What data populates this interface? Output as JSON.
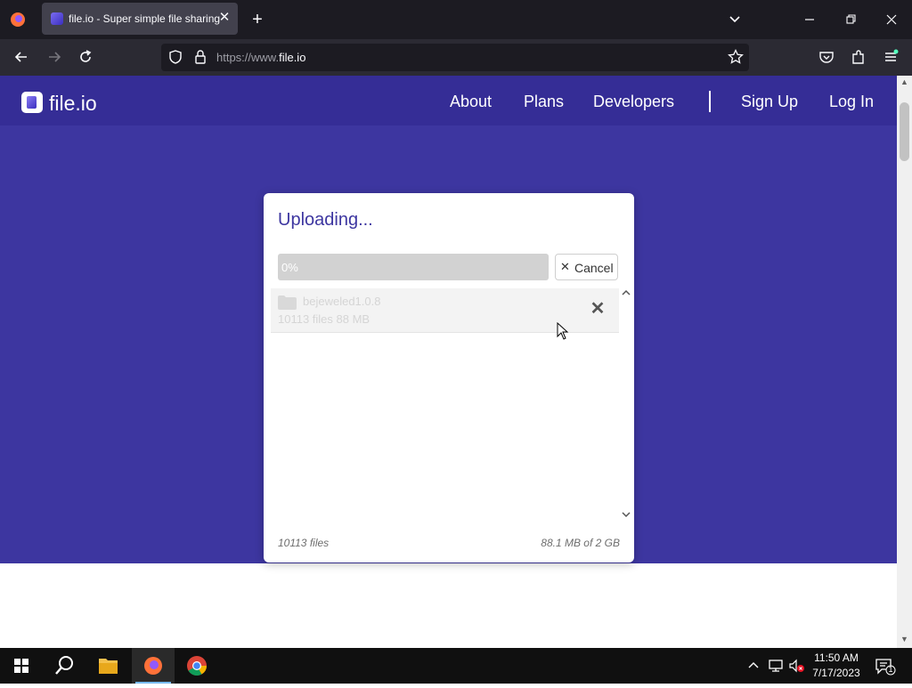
{
  "browser": {
    "tab_title": "file.io - Super simple file sharing",
    "url_prefix": "https://www.",
    "url_domain": "file.io"
  },
  "site": {
    "logo_text": "file.io",
    "nav": {
      "about": "About",
      "plans": "Plans",
      "developers": "Developers",
      "sign_up": "Sign Up",
      "log_in": "Log In"
    }
  },
  "modal": {
    "title": "Uploading...",
    "progress_text": "0%",
    "progress_value": 0,
    "cancel_label": "Cancel",
    "file": {
      "name": "bejeweled1.0.8",
      "meta": "10113 files 88 MB"
    },
    "footer_files": "10113 files",
    "footer_storage": "88.1 MB of 2 GB"
  },
  "taskbar": {
    "time": "11:50 AM",
    "date": "7/17/2023",
    "notification_count": "1"
  },
  "colors": {
    "brand": "#3d36a0",
    "header": "#352d96"
  }
}
